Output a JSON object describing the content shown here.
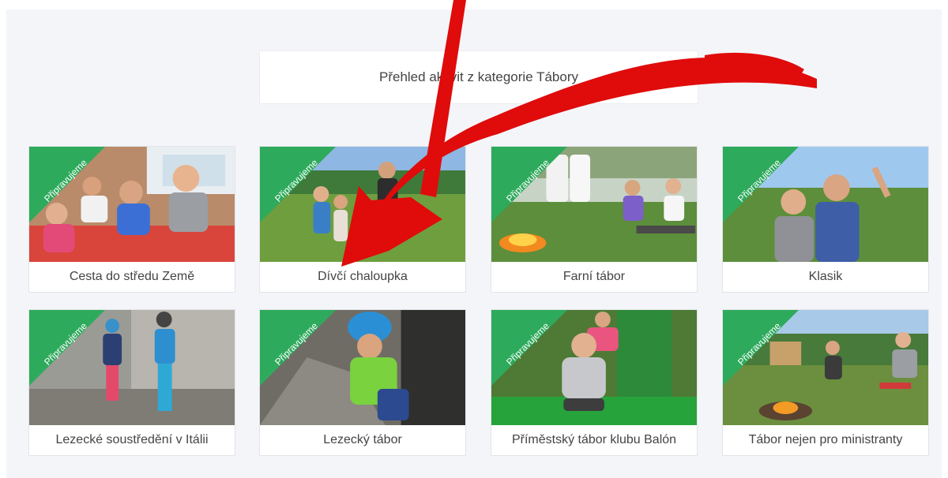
{
  "header": {
    "title": "Přehled aktivit z kategorie Tábory"
  },
  "badge_label": "Připravujeme",
  "colors": {
    "badge": "#2eaa5c",
    "annotation": "#e00b0b"
  },
  "cards": [
    {
      "title": "Cesta do středu Země"
    },
    {
      "title": "Dívčí chaloupka"
    },
    {
      "title": "Farní tábor"
    },
    {
      "title": "Klasik"
    },
    {
      "title": "Lezecké soustředění v Itálii"
    },
    {
      "title": "Lezecký tábor"
    },
    {
      "title": "Příměstský tábor klubu Balón"
    },
    {
      "title": "Tábor nejen pro ministranty"
    }
  ]
}
